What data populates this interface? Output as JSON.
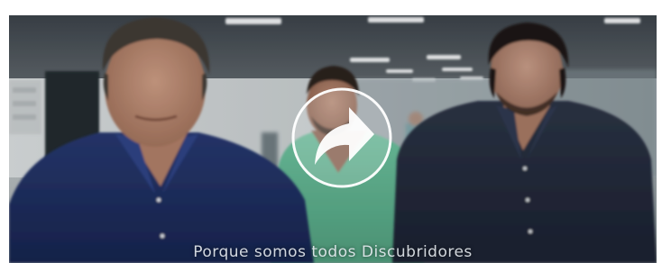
{
  "video": {
    "subtitle": "Porque somos todos Discubridores",
    "play_icon": "play-share-arrow-icon",
    "colors": {
      "ceiling": "#3a4148",
      "wall": "#cfd4d6",
      "shirt_navy": "#1f2f63",
      "scrubs_green": "#5fae8c",
      "shirt_dark": "#232a3a",
      "play_overlay": "#ffffff"
    }
  }
}
